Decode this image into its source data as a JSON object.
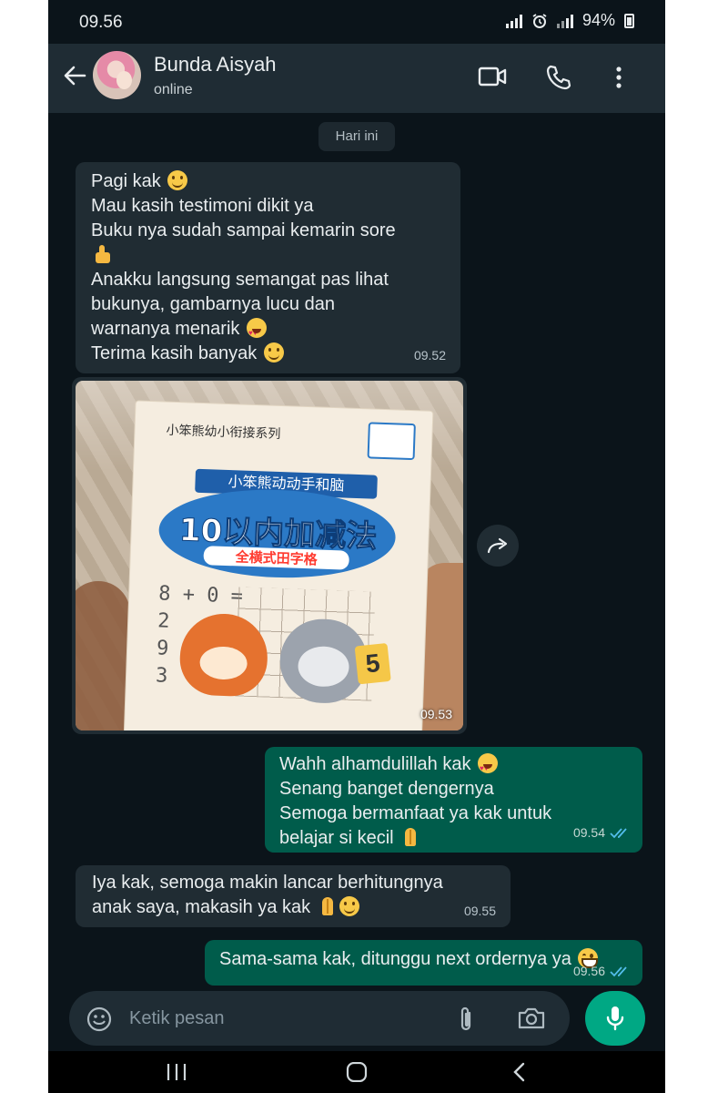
{
  "status_bar": {
    "time": "09.56",
    "battery": "94%"
  },
  "header": {
    "contact_name": "Bunda Aisyah",
    "contact_status": "online"
  },
  "chat": {
    "date_chip": "Hari ini",
    "messages": [
      {
        "direction": "incoming",
        "lines": [
          "Pagi kak",
          "Mau kasih testimoni dikit ya",
          "Buku nya sudah sampai kemarin sore",
          "",
          "Anakku langsung semangat pas lihat",
          "bukunya, gambarnya lucu dan",
          "warnanya menarik",
          "Terima kasih banyak"
        ],
        "emoji_icons": [
          "smile-emoji",
          "thumbs-up-emoji",
          "smiling-face-with-hearts-emoji",
          "smile-emoji"
        ],
        "time": "09.52"
      },
      {
        "direction": "incoming",
        "type": "image",
        "image_text": {
          "series": "小笨熊幼小衔接系列",
          "subtitle": "小笨熊动动手和脑",
          "title": "10以内加减法",
          "subtitle2": "全横式田字格",
          "math_rows": [
            "8 + 0 =",
            "2",
            "9",
            "3"
          ],
          "card_digit": "5"
        },
        "time": "09.53"
      },
      {
        "direction": "outgoing",
        "lines": [
          "Wahh alhamdulillah kak",
          "Senang banget dengernya",
          "Semoga bermanfaat ya kak untuk",
          "belajar si kecil"
        ],
        "emoji_icons": [
          "heart-eyes-emoji",
          "praying-hands-emoji"
        ],
        "time": "09.54",
        "read": true
      },
      {
        "direction": "incoming",
        "lines": [
          "Iya kak, semoga makin lancar berhitungnya",
          "anak saya, makasih ya kak"
        ],
        "emoji_icons": [
          "praying-hands-emoji",
          "smile-emoji"
        ],
        "time": "09.55"
      },
      {
        "direction": "outgoing",
        "lines": [
          "Sama-sama kak, ditunggu next ordernya ya"
        ],
        "emoji_icons": [
          "grin-emoji"
        ],
        "time": "09.56",
        "read": true
      }
    ]
  },
  "composer": {
    "placeholder": "Ketik pesan"
  },
  "colors": {
    "chat_background": "#0b141a",
    "header_background": "#1f2c34",
    "incoming_bubble": "#202c33",
    "outgoing_bubble": "#005c4b",
    "accent_green": "#00a884",
    "read_tick_blue": "#53bdeb"
  },
  "icons": [
    "back-arrow-icon",
    "video-call-icon",
    "voice-call-icon",
    "more-options-icon",
    "forward-icon",
    "emoji-icon",
    "attach-icon",
    "camera-icon",
    "mic-icon"
  ]
}
